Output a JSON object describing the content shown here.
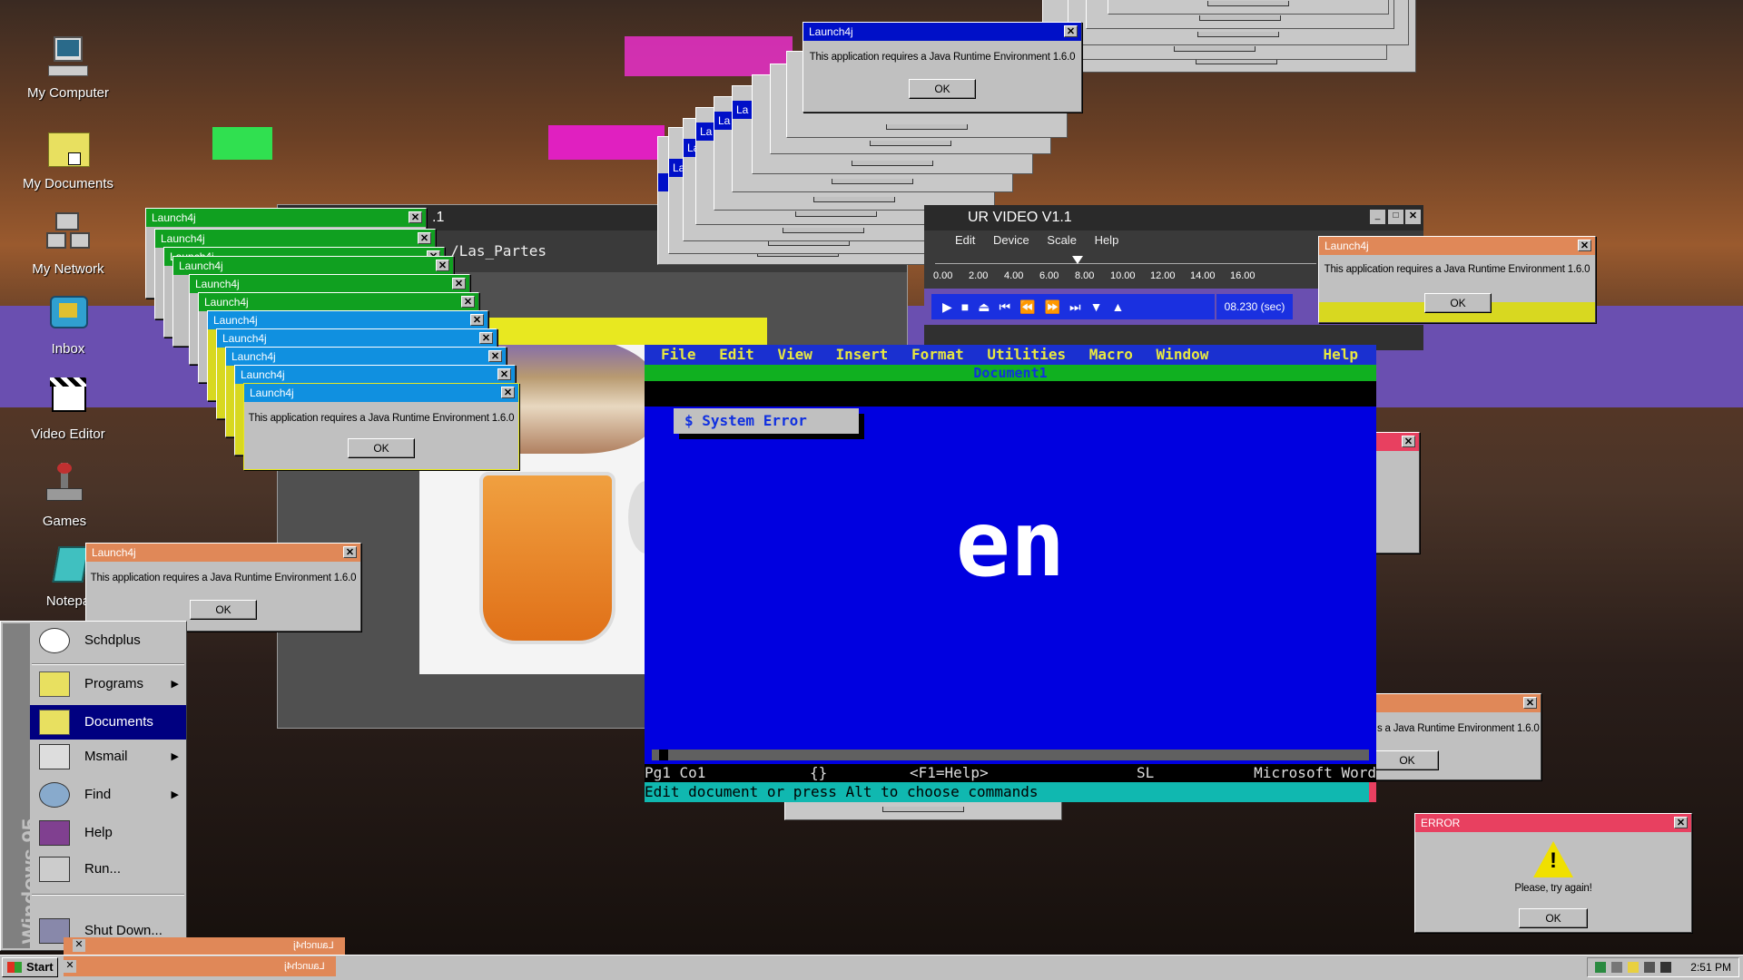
{
  "desktop": {
    "icons": [
      {
        "label": "My Computer"
      },
      {
        "label": "My Documents"
      },
      {
        "label": "My Network"
      },
      {
        "label": "Inbox"
      },
      {
        "label": "Video Editor"
      },
      {
        "label": "Games"
      },
      {
        "label": "Notepa"
      }
    ]
  },
  "dialogs": {
    "app_title": "Launch4j",
    "message": "This application requires a Java Runtime Environment 1.6.0",
    "message_partial": "s a Java Runtime Environment 1.6.0",
    "ok": "OK",
    "close": "✕",
    "title_partial": "La"
  },
  "error_dialog": {
    "title": "ERROR",
    "message": "Please, try again!",
    "ok": "OK"
  },
  "editor_bg": {
    "title_fragment": ".1",
    "path_text": "/Las_Partes"
  },
  "video": {
    "title": "UR VIDEO V1.1",
    "menu": [
      "Edit",
      "Device",
      "Scale",
      "Help"
    ],
    "ticks": [
      "0.00",
      "2.00",
      "4.00",
      "6.00",
      "8.00",
      "10.00",
      "12.00",
      "14.00",
      "16.00"
    ],
    "time": "08.230 (sec)"
  },
  "word": {
    "menu": [
      "File",
      "Edit",
      "View",
      "Insert",
      "Format",
      "Utilities",
      "Macro",
      "Window",
      "Help"
    ],
    "doc_title": "Document1",
    "system_error": "$ System Error",
    "big_text": "en",
    "status": {
      "pos": "Pg1 Co1",
      "braces": "{}",
      "help": "<F1=Help>",
      "mode": "SL",
      "app": "Microsoft Word"
    },
    "prompt": "Edit document or press Alt to choose commands"
  },
  "start_menu": {
    "brand": "Windows 95",
    "items": [
      {
        "label": "Schdplus",
        "arrow": ""
      },
      {
        "label": "Programs",
        "arrow": "▶"
      },
      {
        "label": "Documents",
        "arrow": ""
      },
      {
        "label": "Msmail",
        "arrow": "▶"
      },
      {
        "label": "Find",
        "arrow": "▶"
      },
      {
        "label": "Help",
        "arrow": ""
      },
      {
        "label": "Run...",
        "arrow": ""
      },
      {
        "label": "Shut Down...",
        "arrow": ""
      }
    ]
  },
  "taskbar": {
    "start": "Start",
    "tasks": [
      "Launch4j",
      "Launch4j"
    ],
    "clock": "2:51 PM"
  },
  "colors": {
    "win_blue": "#0010c8",
    "green": "#10b020",
    "orange": "#e08858",
    "yellow": "#d8d820",
    "magenta": "#e020c0",
    "word_blue": "#0000e0",
    "teal": "#10b8b0",
    "desktop_purple": "#6a4fb0"
  }
}
